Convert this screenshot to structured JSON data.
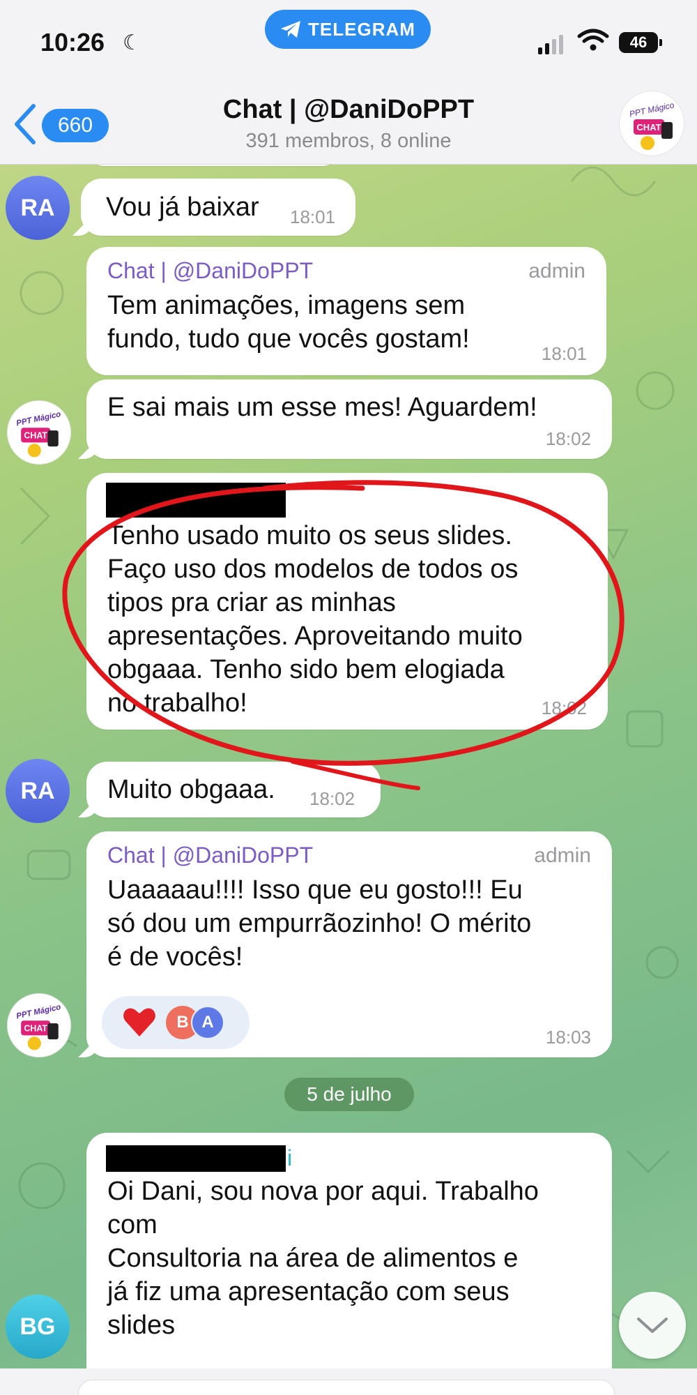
{
  "status_bar": {
    "time": "10:26",
    "battery": "46",
    "pill_label": "TELEGRAM"
  },
  "header": {
    "back_count": "660",
    "title": "Chat | @DaniDoPPT",
    "subtitle": "391 membros, 8 online",
    "avatar_text": "PPT Mágico",
    "avatar_badge": "CHAT"
  },
  "messages": [
    {
      "avatar": "RA",
      "text": "Vou já baixar",
      "time": "18:01"
    },
    {
      "sender": "Chat | @DaniDoPPT",
      "role": "admin",
      "lines": [
        "Tem animações, imagens sem",
        "fundo, tudo que vocês gostam!"
      ],
      "time": "18:01"
    },
    {
      "text": "E sai mais um esse mes! Aguardem!",
      "time": "18:02"
    },
    {
      "lines": [
        "Tenho usado muito os seus slides.",
        "Faço uso dos modelos de todos os",
        "tipos pra criar as minhas",
        "apresentações. Aproveitando muito",
        "obgaaa. Tenho sido bem elogiada",
        "no trabalho!"
      ],
      "time": "18:02"
    },
    {
      "avatar": "RA",
      "text": "Muito obgaaa.",
      "time": "18:02"
    },
    {
      "sender": "Chat | @DaniDoPPT",
      "role": "admin",
      "lines": [
        "Uaaaaau!!!! Isso que eu gosto!!! Eu",
        "só dou um empurrãozinho! O mérito",
        "é de vocês!"
      ],
      "time": "18:03",
      "reactions": {
        "emoji": "❤️",
        "users": [
          "B",
          "A"
        ]
      }
    },
    {
      "avatar": "BG",
      "sender_suffix": "i",
      "lines": [
        "Oi Dani, sou nova por aqui. Trabalho",
        "com",
        "Consultoria na área de alimentos e",
        "já fiz uma apresentação com seus",
        "slides"
      ]
    }
  ],
  "date_separator": "5 de julho",
  "colors": {
    "accent": "#2a8cf0",
    "sender": "#7b5cc6",
    "annotation": "#e0161b"
  }
}
